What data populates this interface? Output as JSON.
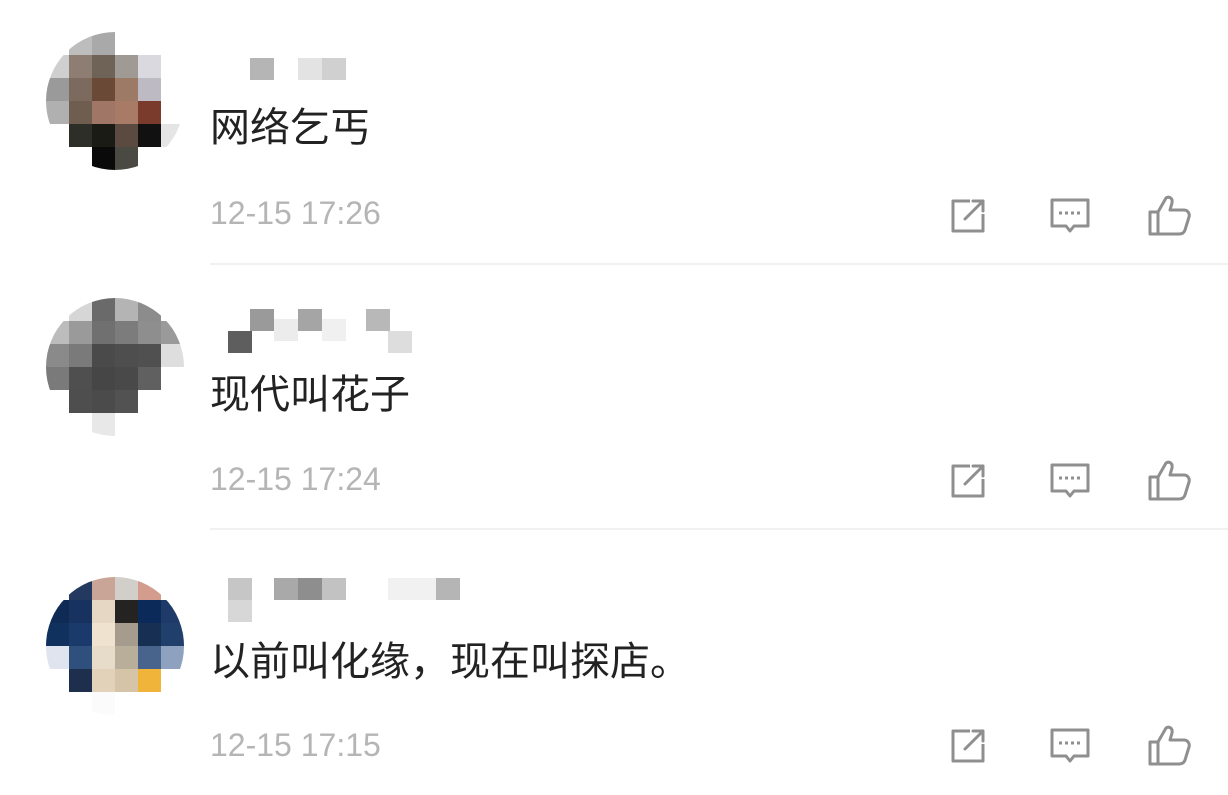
{
  "comments": [
    {
      "text": "网络乞丐",
      "time": "12-15 17:26",
      "avatar_pixels": [
        "#ffffff",
        "#bdbdbd",
        "#a9a9a9",
        "#ffffff",
        "#ffffff",
        "#ffffff",
        "#cfcfcf",
        "#8d7d72",
        "#6f6256",
        "#a09a95",
        "#d9d9df",
        "#ffffff",
        "#9a9a9a",
        "#7b6a5d",
        "#6a4a36",
        "#9c7a66",
        "#bdbac3",
        "#ffffff",
        "#b0b0b0",
        "#6f5e50",
        "#a07766",
        "#a77b66",
        "#7a3b2c",
        "#ffffff",
        "#ffffff",
        "#2e2e28",
        "#1b1b16",
        "#5a4a3f",
        "#111111",
        "#e5e5e5",
        "#ffffff",
        "#ffffff",
        "#0a0a0a",
        "#4a4a42",
        "#ffffff",
        "#ffffff"
      ],
      "username_blocks": [
        "#b5b5b5",
        "#e3e3e3",
        "#d0d0d0"
      ]
    },
    {
      "text": "现代叫花子",
      "time": "12-15 17:24",
      "avatar_pixels": [
        "#ffffff",
        "#d6d6d6",
        "#6a6a6a",
        "#b4b4b4",
        "#8c8c8c",
        "#ffffff",
        "#bcbcbc",
        "#9a9a9a",
        "#707070",
        "#7c7c7c",
        "#8e8e8e",
        "#9a9a9a",
        "#8a8a8a",
        "#7a7a7a",
        "#4a4a4a",
        "#4e4e4e",
        "#505050",
        "#dedede",
        "#7a7a7a",
        "#4f4f4f",
        "#464646",
        "#494949",
        "#606060",
        "#ffffff",
        "#ffffff",
        "#4e4e4e",
        "#4b4b4b",
        "#525252",
        "#ffffff",
        "#ffffff",
        "#ffffff",
        "#ffffff",
        "#e8e8e8",
        "#ffffff",
        "#ffffff",
        "#ffffff"
      ],
      "username_blocks": [
        "#5e5e5e",
        "#9a9a9a",
        "#ececec",
        "#a5a5a5",
        "#f0f0f0",
        "#b8b8b8",
        "#dddddd"
      ]
    },
    {
      "text": "以前叫化缘，现在叫探店。",
      "time": "12-15 17:15",
      "avatar_pixels": [
        "#ffffff",
        "#24395f",
        "#c8a597",
        "#d2cfca",
        "#d39c8c",
        "#ffffff",
        "#0f2a55",
        "#17325e",
        "#e6d7c4",
        "#252321",
        "#0c2a59",
        "#1d3a68",
        "#10305e",
        "#193a6a",
        "#efe3cf",
        "#a59c8e",
        "#182f54",
        "#203f6b",
        "#dfe4ee",
        "#2f4f7c",
        "#e7dcc9",
        "#b9ae9a",
        "#48648d",
        "#8ea2bf",
        "#ffffff",
        "#1d2f4d",
        "#e2d2b9",
        "#d5c4a8",
        "#f0b43a",
        "#ffffff",
        "#ffffff",
        "#ffffff",
        "#fbfbfb",
        "#ffffff",
        "#ffffff",
        "#ffffff"
      ],
      "username_blocks": [
        "#c6c6c6",
        "#d7d7d7",
        "#a9a9a9",
        "#8e8e8e",
        "#c2c2c2",
        "#f1f1f1",
        "#b5b5b5"
      ]
    }
  ],
  "colors": {
    "text": "#222222",
    "timestamp": "#b5b5b5",
    "icon": "#8f8f8f",
    "divider": "#f1f1f1"
  },
  "icons": [
    "share-icon",
    "reply-icon",
    "like-icon"
  ]
}
